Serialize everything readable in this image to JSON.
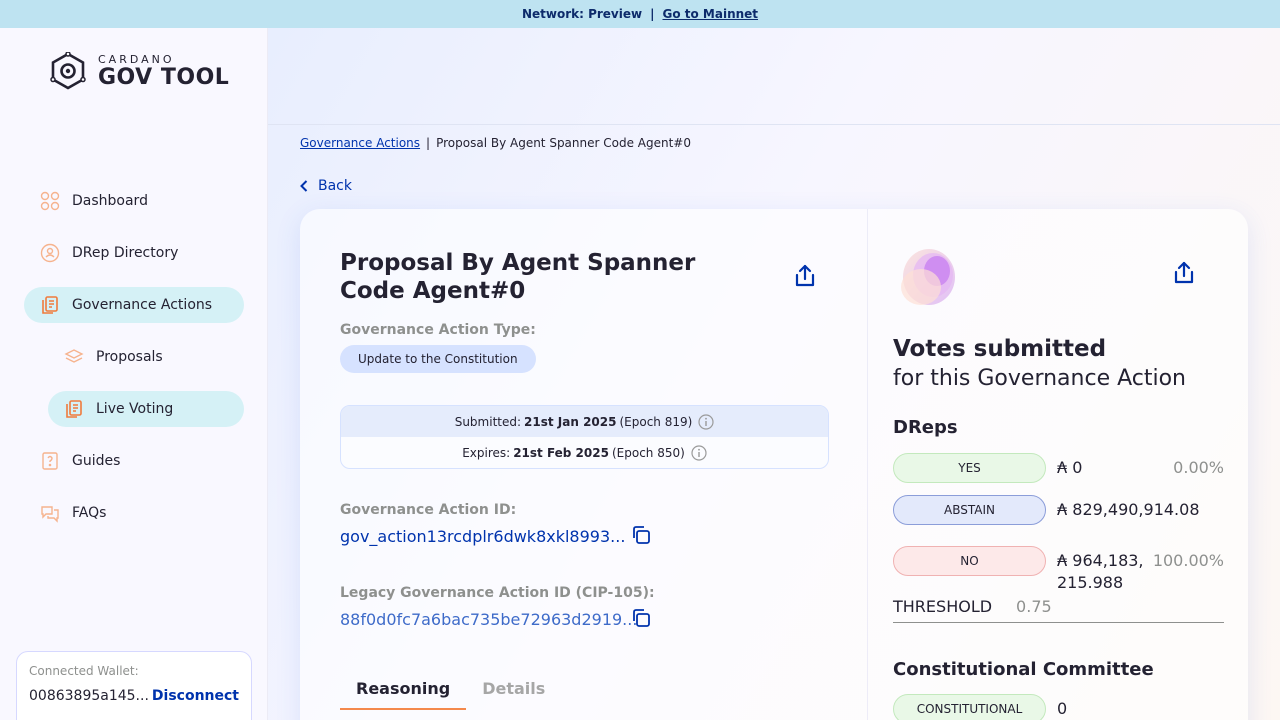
{
  "banner": {
    "network": "Network: Preview",
    "separator": "|",
    "link": "Go to Mainnet"
  },
  "logo": {
    "small": "CARDANO",
    "big": "GOV TOOL"
  },
  "sidebar": {
    "items": [
      {
        "label": "Dashboard",
        "icon": "dashboard-icon"
      },
      {
        "label": "DRep Directory",
        "icon": "drep-directory-icon"
      },
      {
        "label": "Governance Actions",
        "icon": "governance-actions-icon"
      },
      {
        "label": "Proposals",
        "icon": "proposals-icon"
      },
      {
        "label": "Live Voting",
        "icon": "live-voting-icon"
      },
      {
        "label": "Guides",
        "icon": "guides-icon"
      },
      {
        "label": "FAQs",
        "icon": "faqs-icon"
      }
    ]
  },
  "wallet": {
    "label": "Connected Wallet:",
    "address": "00863895a145...",
    "disconnect": "Disconnect"
  },
  "breadcrumb": {
    "link": "Governance Actions",
    "current": "Proposal By Agent Spanner Code Agent#0"
  },
  "back_label": "Back",
  "proposal": {
    "title": "Proposal By Agent Spanner Code Agent#0",
    "type_label": "Governance Action Type:",
    "type_value": "Update to the Constitution",
    "submitted_label": "Submitted:",
    "submitted_date": "21st Jan 2025",
    "submitted_epoch": "(Epoch 819)",
    "expires_label": "Expires:",
    "expires_date": "21st Feb 2025",
    "expires_epoch": "(Epoch 850)",
    "id_label": "Governance Action ID:",
    "id_value": "gov_action13rcdplr6dwk8xkl8993...",
    "legacy_label": "Legacy Governance Action ID (CIP-105):",
    "legacy_value": "88f0d0fc7a6bac735be72963d2919..."
  },
  "tabs": [
    {
      "label": "Reasoning"
    },
    {
      "label": "Details"
    }
  ],
  "votes": {
    "title": "Votes submitted",
    "subtitle": "for this Governance Action",
    "dreps_title": "DReps",
    "rows": [
      {
        "label": "YES",
        "amount": "₳ 0",
        "percent": "0.00%"
      },
      {
        "label": "ABSTAIN",
        "amount": "₳ 829,490,914.08",
        "percent": ""
      },
      {
        "label": "NO",
        "amount": "₳ 964,183,215.988",
        "percent": "100.00%"
      }
    ],
    "threshold_label": "THRESHOLD",
    "threshold_value": "0.75",
    "cc_title": "Constitutional Committee",
    "cc_row": {
      "label": "CONSTITUTIONAL",
      "amount": "0"
    }
  },
  "colors": {
    "accent": "#0033ad",
    "active_nav": "#d5f1f6",
    "tab_underline": "#f4894c",
    "banner": "#bee3f1"
  }
}
